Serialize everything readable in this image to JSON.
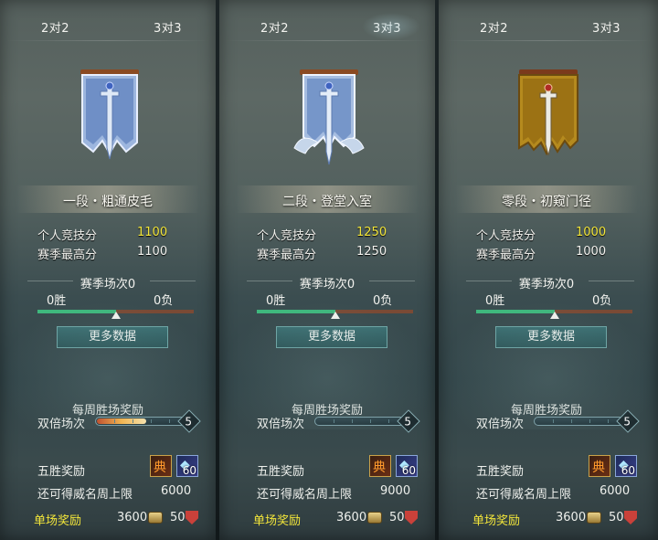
{
  "panels": [
    {
      "tabs": [
        "2对2",
        "3对3"
      ],
      "active_tab": 0,
      "emblem": "plain-blue-sword-banner-icon",
      "rank_name": "一段・粗通皮毛",
      "personal_label": "个人竞技分",
      "personal_value": "1100",
      "season_high_label": "赛季最高分",
      "season_high_value": "1100",
      "season_title": "赛季场次0",
      "wins": "0胜",
      "losses": "0负",
      "win_ratio": 0.5,
      "more_button": "更多数据",
      "weekly_title": "每周胜场奖励",
      "double_label": "双倍场次",
      "double_count": "5",
      "double_fill": 0.55,
      "five_win_label": "五胜奖励",
      "reward_items": [
        {
          "icon": "skill-book-icon",
          "count": "5"
        },
        {
          "icon": "blue-crystal-icon",
          "count": "60"
        }
      ],
      "limit_label": "还可得威名周上限",
      "limit_value": "6000",
      "single_label": "单场奖励",
      "single_coin": "3600",
      "single_fame": "50"
    },
    {
      "tabs": [
        "2对2",
        "3对3"
      ],
      "active_tab": 1,
      "emblem": "winged-blue-sword-banner-icon",
      "rank_name": "二段・登堂入室",
      "personal_label": "个人竞技分",
      "personal_value": "1250",
      "season_high_label": "赛季最高分",
      "season_high_value": "1250",
      "season_title": "赛季场次0",
      "wins": "0胜",
      "losses": "0负",
      "win_ratio": 0.5,
      "more_button": "更多数据",
      "weekly_title": "每周胜场奖励",
      "double_label": "双倍场次",
      "double_count": "5",
      "double_fill": 0,
      "five_win_label": "五胜奖励",
      "reward_items": [
        {
          "icon": "skill-book-icon",
          "count": "5"
        },
        {
          "icon": "blue-crystal-icon",
          "count": "60"
        }
      ],
      "limit_label": "还可得威名周上限",
      "limit_value": "9000",
      "single_label": "单场奖励",
      "single_coin": "3600",
      "single_fame": "50"
    },
    {
      "tabs": [
        "2对2",
        "3对3"
      ],
      "active_tab": 0,
      "emblem": "tattered-gold-sword-banner-icon",
      "rank_name": "零段・初窥门径",
      "personal_label": "个人竞技分",
      "personal_value": "1000",
      "season_high_label": "赛季最高分",
      "season_high_value": "1000",
      "season_title": "赛季场次0",
      "wins": "0胜",
      "losses": "0负",
      "win_ratio": 0.5,
      "more_button": "更多数据",
      "weekly_title": "每周胜场奖励",
      "double_label": "双倍场次",
      "double_count": "5",
      "double_fill": 0,
      "five_win_label": "五胜奖励",
      "reward_items": [
        {
          "icon": "skill-book-icon",
          "count": "5"
        },
        {
          "icon": "blue-crystal-icon",
          "count": "60"
        }
      ],
      "limit_label": "还可得威名周上限",
      "limit_value": "6000",
      "single_label": "单场奖励",
      "single_coin": "3600",
      "single_fame": "50"
    }
  ],
  "colors": {
    "highlight_score": "#f3e63a",
    "win_bar": "#3fb87d",
    "loss_bar": "#7a4a35",
    "button_bg": "#2f5e61"
  }
}
